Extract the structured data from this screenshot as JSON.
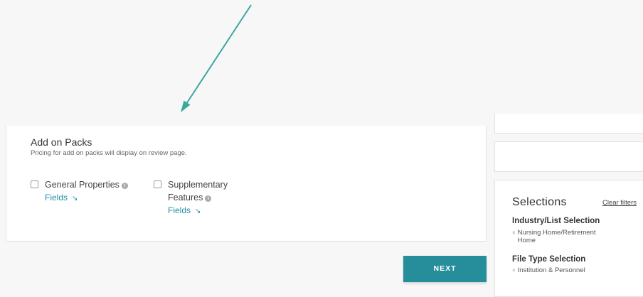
{
  "add_on_packs": {
    "title": "Add on Packs",
    "subtitle": "Pricing for add on packs will display on review page.",
    "packs": [
      {
        "label": "General Properties",
        "fields_label": "Fields",
        "fields_arrow": "↘"
      },
      {
        "label_line1": "Supplementary",
        "label_line2": "Features",
        "fields_label": "Fields",
        "fields_arrow": "↘"
      }
    ]
  },
  "selections": {
    "title": "Selections",
    "clear_label": "Clear filters",
    "groups": [
      {
        "title": "Industry/List Selection",
        "items": [
          {
            "remove": "×",
            "line1": "Nursing Home/Retirement",
            "line2": "Home"
          }
        ]
      },
      {
        "title": "File Type Selection",
        "items": [
          {
            "remove": "×",
            "line1": "Institution & Personnel"
          }
        ]
      }
    ]
  },
  "next_label": "NEXT",
  "annotation": {
    "arrow_color": "#3aa89f"
  },
  "colors": {
    "accent": "#268e9b",
    "link": "#1f8fa8"
  }
}
